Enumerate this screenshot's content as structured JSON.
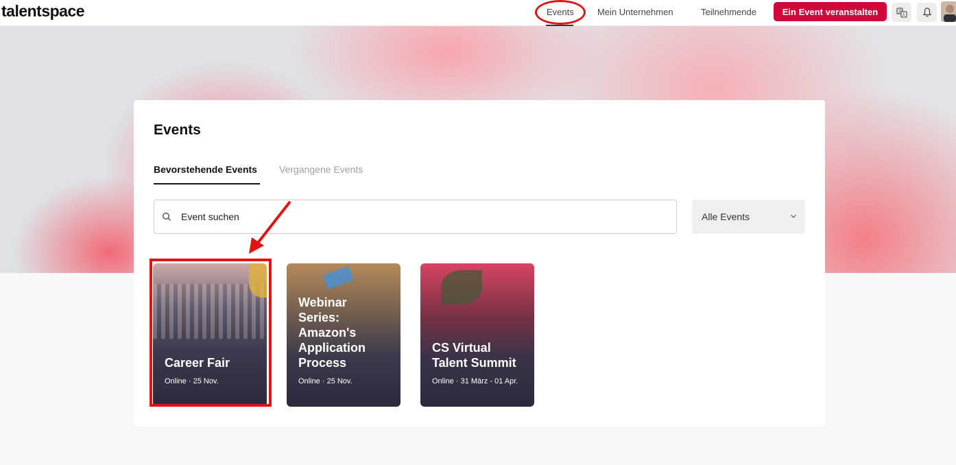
{
  "header": {
    "logo": "talentspace",
    "nav": {
      "events": "Events",
      "company": "Mein Unternehmen",
      "participants": "Teilnehmende"
    },
    "cta_label": "Ein Event veranstalten",
    "icons": [
      "translate-icon",
      "bell-icon"
    ]
  },
  "main": {
    "title": "Events",
    "tabs": [
      {
        "label": "Bevorstehende Events",
        "active": true
      },
      {
        "label": "Vergangene Events",
        "active": false
      }
    ],
    "search": {
      "placeholder": "Event suchen"
    },
    "filter": {
      "selected": "Alle Events"
    },
    "events": [
      {
        "title": "Career Fair",
        "meta": "Online · 25 Nov."
      },
      {
        "title": "Webinar Series: Amazon's Application Process",
        "meta": "Online · 25 Nov."
      },
      {
        "title": "CS Virtual Talent Summit",
        "meta": "Online · 31 März - 01 Apr."
      }
    ]
  },
  "colors": {
    "brand": "#d0073b",
    "annotation": "#e11414"
  }
}
